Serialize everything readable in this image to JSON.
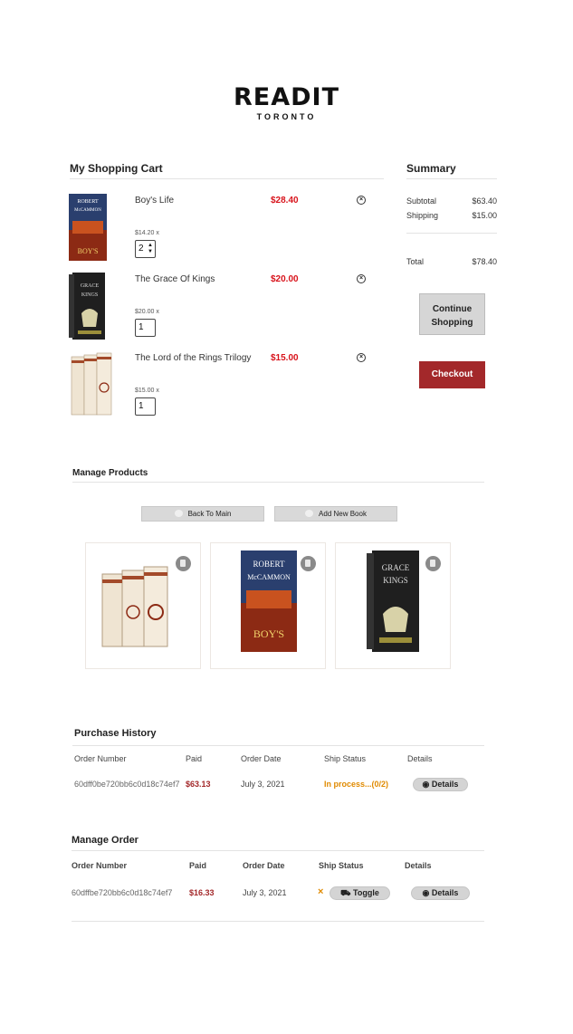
{
  "logo": {
    "main": "READIT",
    "sub": "TORONTO"
  },
  "cart": {
    "title": "My Shopping Cart",
    "items": [
      {
        "title": "Boy's Life",
        "price": "$28.40",
        "unit": "$14.20 x",
        "qty": "2",
        "cover_text": "ROBERT McCAMMON"
      },
      {
        "title": "The Grace Of Kings",
        "price": "$20.00",
        "unit": "$20.00 x",
        "qty": "1",
        "cover_text": "GRACE OF KINGS"
      },
      {
        "title": "The Lord of the Rings Trilogy",
        "price": "$15.00",
        "unit": "$15.00 x",
        "qty": "1",
        "cover_text": ""
      }
    ]
  },
  "summary": {
    "title": "Summary",
    "subtotal_label": "Subtotal",
    "subtotal": "$63.40",
    "shipping_label": "Shipping",
    "shipping": "$15.00",
    "total_label": "Total",
    "total": "$78.40",
    "continue_label": "Continue Shopping",
    "checkout_label": "Checkout"
  },
  "manage_products": {
    "title": "Manage Products",
    "back_label": "Back To Main",
    "add_label": "Add New Book"
  },
  "purchase_history": {
    "title": "Purchase History",
    "headers": [
      "Order Number",
      "Paid",
      "Order Date",
      "Ship Status",
      "Details"
    ],
    "row": {
      "order": "60dff0be720bb6c0d18c74ef7",
      "paid": "$63.13",
      "date": "July 3, 2021",
      "status": "In process...(0/2)",
      "details": "Details"
    }
  },
  "manage_order": {
    "title": "Manage Order",
    "headers": [
      "Order Number",
      "Paid",
      "Order Date",
      "Ship Status",
      "Details"
    ],
    "row": {
      "order": "60dffbe720bb6c0d18c74ef7",
      "paid": "$16.33",
      "date": "July 3, 2021",
      "status_icon": "×",
      "toggle": "Toggle",
      "details": "Details"
    }
  },
  "colors": {
    "accent": "#a3282a",
    "price": "#d8131b",
    "status": "#e08a00"
  }
}
